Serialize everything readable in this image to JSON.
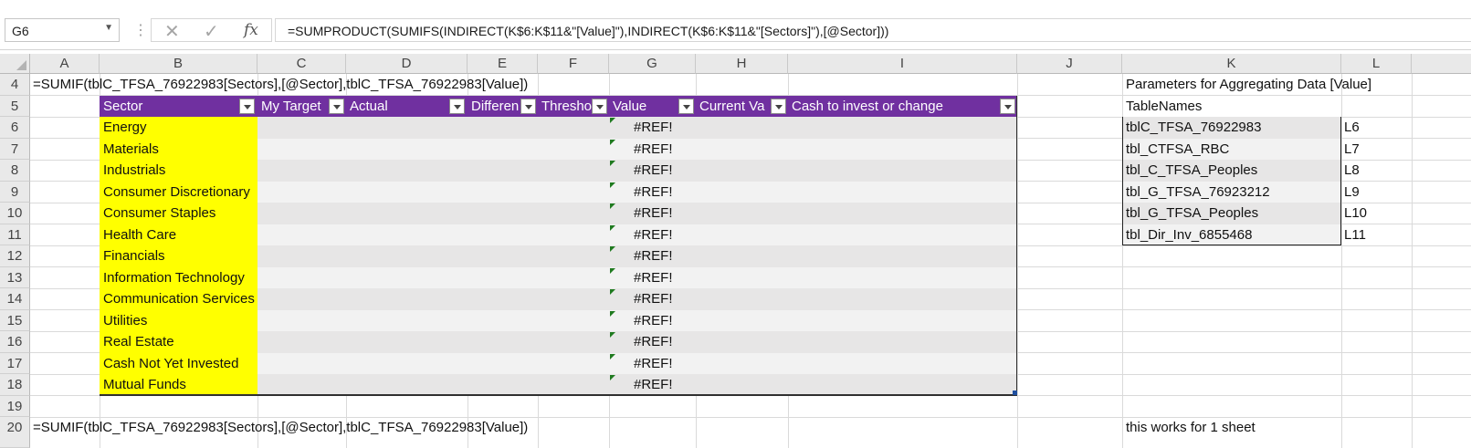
{
  "formula_bar": {
    "name_box": "G6",
    "formula": "=SUMPRODUCT(SUMIFS(INDIRECT(K$6:K$11&\"[Value]\"),INDIRECT(K$6:K$11&\"[Sectors]\"),[@Sector]))"
  },
  "columns": [
    "A",
    "B",
    "C",
    "D",
    "E",
    "F",
    "G",
    "H",
    "I",
    "J",
    "K",
    "L"
  ],
  "rows": [
    "4",
    "5",
    "6",
    "7",
    "8",
    "9",
    "10",
    "11",
    "12",
    "13",
    "14",
    "15",
    "16",
    "17",
    "18",
    "19",
    "20"
  ],
  "cells": {
    "a4": "=SUMIF(tblC_TFSA_76922983[Sectors],[@Sector],tblC_TFSA_76922983[Value])",
    "a20": "=SUMIF(tblC_TFSA_76922983[Sectors],[@Sector],tblC_TFSA_76922983[Value])",
    "k4": "Parameters for Aggregating Data [Value]",
    "k5": "TableNames",
    "k20": "this works for 1 sheet"
  },
  "table": {
    "headers": [
      "Sector",
      "My Target",
      "Actual",
      "Differen",
      "Thresho",
      "Value",
      "Current Va",
      "Cash to invest or change"
    ],
    "sectors": [
      "Energy",
      "Materials",
      "Industrials",
      "Consumer Discretionary",
      "Consumer Staples",
      "Health Care",
      "Financials",
      "Information Technology",
      "Communication Services",
      "Utilities",
      "Real Estate",
      "Cash Not Yet Invested",
      "Mutual Funds"
    ],
    "value_error": "#REF!"
  },
  "table_names": [
    {
      "name": "tblC_TFSA_76922983",
      "ref": "L6"
    },
    {
      "name": "tbl_CTFSA_RBC",
      "ref": "L7"
    },
    {
      "name": "tbl_C_TFSA_Peoples",
      "ref": "L8"
    },
    {
      "name": "tbl_G_TFSA_76923212",
      "ref": "L9"
    },
    {
      "name": "tbl_G_TFSA_Peoples",
      "ref": "L10"
    },
    {
      "name": "tbl_Dir_Inv_6855468",
      "ref": "L11"
    }
  ],
  "colors": {
    "table_header": "#7030a0",
    "highlight": "#ffff00",
    "band": "#e7e6e6"
  },
  "icons": [
    "cancel-icon",
    "enter-icon",
    "insert-function-icon",
    "dropdown-arrow-icon"
  ]
}
